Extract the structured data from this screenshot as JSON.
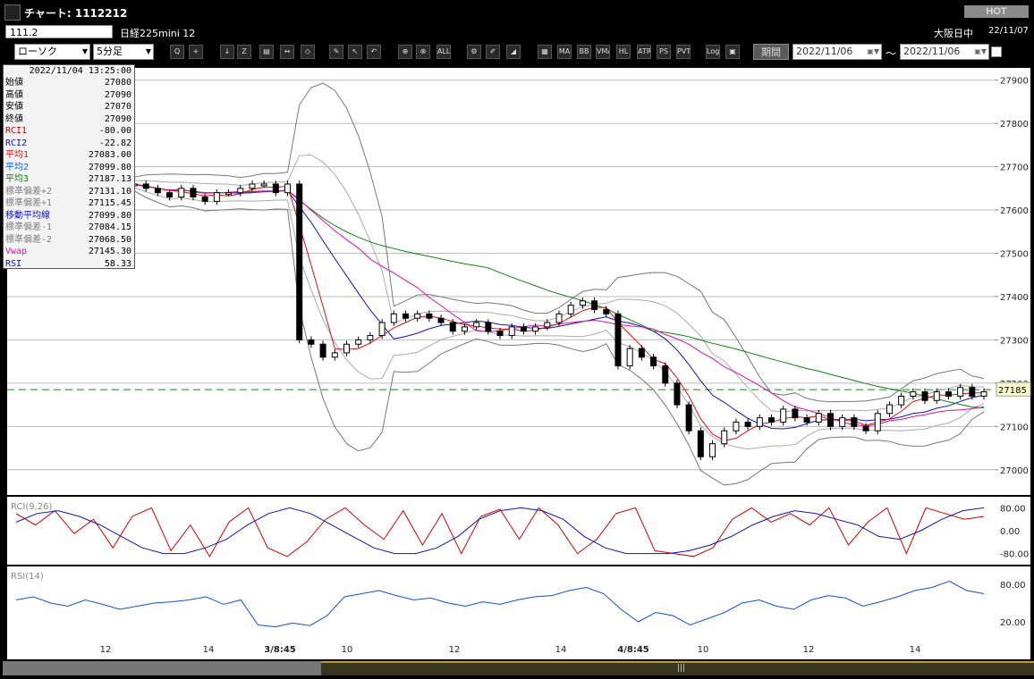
{
  "window": {
    "title": "チャート: 1112212",
    "hot_label": "HOT"
  },
  "info": {
    "symbol": "111.2",
    "instrument": "日経225mini 12",
    "market": "大阪日中",
    "date": "22/11/07"
  },
  "toolbar": {
    "chart_type": "ローソク",
    "interval": "5分足",
    "period_label": "期間",
    "date_from": "2022/11/06",
    "date_to": "2022/11/06",
    "tilde": "～",
    "buttons": [
      {
        "name": "zoom-icon",
        "label": "Q"
      },
      {
        "name": "crosshair-icon",
        "label": "+"
      },
      {
        "name": "download-icon",
        "label": "↓"
      },
      {
        "name": "magnify-chart-icon",
        "label": "Z"
      },
      {
        "name": "bar-chart-icon",
        "label": "▤"
      },
      {
        "name": "split-icon",
        "label": "↔"
      },
      {
        "name": "disabled-icon",
        "label": "◇"
      },
      {
        "name": "pencil-icon",
        "label": "✎"
      },
      {
        "name": "pointer-icon",
        "label": "↖"
      },
      {
        "name": "undo-icon",
        "label": "↶"
      },
      {
        "name": "candle-icon",
        "label": "⊕"
      },
      {
        "name": "candle2-icon",
        "label": "⊗"
      },
      {
        "name": "all-icon",
        "label": "ALL"
      },
      {
        "name": "gear-icon",
        "label": "⚙"
      },
      {
        "name": "brush-icon",
        "label": "✐"
      },
      {
        "name": "color-icon",
        "label": "◢"
      },
      {
        "name": "grid-icon",
        "label": "▦"
      },
      {
        "name": "ma-icon",
        "label": "MA"
      },
      {
        "name": "bb-icon",
        "label": "BB"
      },
      {
        "name": "vwma-icon",
        "label": "VMA"
      },
      {
        "name": "hl-icon",
        "label": "HL"
      },
      {
        "name": "atr-icon",
        "label": "ATR"
      },
      {
        "name": "ps-icon",
        "label": "PS"
      },
      {
        "name": "pvt-icon",
        "label": "PVT"
      },
      {
        "name": "log-icon",
        "label": "Log"
      },
      {
        "name": "export-icon",
        "label": "▣"
      }
    ]
  },
  "data_panel": {
    "timestamp": "2022/11/04  13:25:00",
    "rows": [
      {
        "label": "始値",
        "value": "27080",
        "color": "#000000"
      },
      {
        "label": "高値",
        "value": "27090",
        "color": "#000000"
      },
      {
        "label": "安値",
        "value": "27070",
        "color": "#000000"
      },
      {
        "label": "終値",
        "value": "27090",
        "color": "#000000"
      },
      {
        "label": "RCI1",
        "value": "-80.00",
        "color": "#d00000"
      },
      {
        "label": "RCI2",
        "value": "-22.82",
        "color": "#1010c0"
      },
      {
        "label": "平均1",
        "value": "27083.00",
        "color": "#e01010"
      },
      {
        "label": "平均2",
        "value": "27099.80",
        "color": "#1060e0"
      },
      {
        "label": "平均3",
        "value": "27187.13",
        "color": "#108010"
      },
      {
        "label": "標準偏差+2",
        "value": "27131.10",
        "color": "#808080"
      },
      {
        "label": "標準偏差+1",
        "value": "27115.45",
        "color": "#808080"
      },
      {
        "label": "移動平均線",
        "value": "27099.80",
        "color": "#1010c0"
      },
      {
        "label": "標準偏差-1",
        "value": "27084.15",
        "color": "#808080"
      },
      {
        "label": "標準偏差-2",
        "value": "27068.50",
        "color": "#808080"
      },
      {
        "label": "Vwap",
        "value": "27145.30",
        "color": "#e010a0"
      },
      {
        "label": "RSI",
        "value": "58.33",
        "color": "#1010c0"
      }
    ]
  },
  "chart_data": [
    {
      "type": "candlestick",
      "ylim": [
        26950,
        27920
      ],
      "yticks": [
        27000,
        27100,
        27200,
        27300,
        27400,
        27500,
        27600,
        27700,
        27800,
        27900
      ],
      "xticks": [
        "12",
        "14",
        "3/8:45",
        "10",
        "12",
        "14",
        "4/8:45",
        "10",
        "12",
        "14"
      ],
      "current_price": 27185,
      "close_series": [
        27660,
        27650,
        27640,
        27630,
        27650,
        27630,
        27620,
        27640,
        27640,
        27650,
        27660,
        27660,
        27640,
        27660,
        27300,
        27290,
        27260,
        27270,
        27290,
        27300,
        27310,
        27340,
        27360,
        27350,
        27360,
        27350,
        27340,
        27320,
        27330,
        27340,
        27320,
        27310,
        27330,
        27320,
        27330,
        27340,
        27360,
        27380,
        27390,
        27370,
        27360,
        27240,
        27280,
        27260,
        27240,
        27200,
        27150,
        27090,
        27030,
        27060,
        27090,
        27110,
        27100,
        27120,
        27110,
        27140,
        27120,
        27110,
        27130,
        27100,
        27120,
        27100,
        27090,
        27130,
        27150,
        27170,
        27180,
        27160,
        27180,
        27170,
        27190,
        27170,
        27180
      ]
    },
    {
      "type": "line",
      "title": "RCI(9,26)",
      "ylim": [
        -100,
        100
      ],
      "yticks": [
        "80.00",
        "0.00",
        "-80.00"
      ],
      "series": [
        {
          "color": "#d00000",
          "values": [
            60,
            20,
            70,
            -10,
            40,
            -60,
            50,
            80,
            -70,
            20,
            -90,
            30,
            80,
            -60,
            -90,
            -40,
            40,
            80,
            20,
            -30,
            70,
            -50,
            60,
            -80,
            50,
            75,
            -30,
            80,
            20,
            -80,
            -30,
            60,
            80,
            -70,
            -80,
            -90,
            -60,
            40,
            80,
            30,
            60,
            20,
            80,
            -50,
            30,
            80,
            -80,
            80,
            60,
            40,
            50
          ]
        },
        {
          "color": "#1010c0",
          "values": [
            30,
            60,
            70,
            50,
            20,
            -20,
            -60,
            -80,
            -80,
            -60,
            -30,
            20,
            60,
            80,
            60,
            20,
            -20,
            -60,
            -80,
            -80,
            -60,
            -20,
            40,
            70,
            80,
            70,
            40,
            -20,
            -60,
            -80,
            -80,
            -80,
            -70,
            -50,
            -20,
            20,
            50,
            70,
            60,
            40,
            20,
            -20,
            -30,
            0,
            40,
            70,
            80
          ]
        }
      ]
    },
    {
      "type": "line",
      "title": "RSI(14)",
      "ylim": [
        0,
        100
      ],
      "yticks": [
        "80.00",
        "20.00"
      ],
      "series": [
        {
          "color": "#1050e0",
          "values": [
            55,
            60,
            50,
            45,
            55,
            48,
            40,
            45,
            50,
            52,
            55,
            60,
            48,
            55,
            15,
            12,
            18,
            14,
            30,
            60,
            65,
            70,
            62,
            55,
            58,
            50,
            45,
            52,
            48,
            55,
            60,
            62,
            70,
            75,
            65,
            40,
            20,
            35,
            30,
            15,
            25,
            35,
            50,
            55,
            45,
            40,
            55,
            62,
            58,
            45,
            52,
            60,
            70,
            75,
            85,
            70,
            65
          ]
        }
      ]
    }
  ]
}
